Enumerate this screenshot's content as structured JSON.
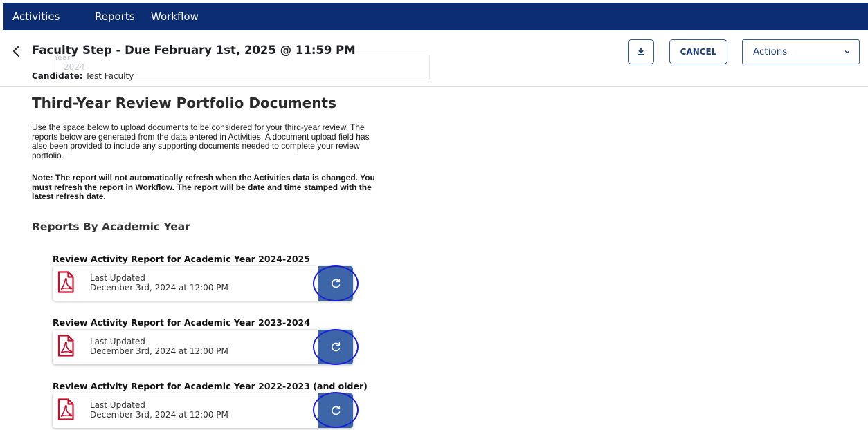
{
  "nav": {
    "items": [
      {
        "label": "Activities"
      },
      {
        "label": "Reports"
      },
      {
        "label": "Workflow"
      }
    ]
  },
  "header": {
    "title": "Faculty Step - Due February 1st, 2025 @ 11:59 PM",
    "ghost_label": "Year*",
    "ghost_value": "2024",
    "candidate_label": "Candidate:",
    "candidate_name": "Test Faculty",
    "cancel_label": "CANCEL",
    "actions_label": "Actions"
  },
  "content": {
    "section_title": "Third-Year Review Portfolio Documents",
    "description": "Use the space below to upload documents to be considered for your third-year review. The reports below are generated from the data entered in Activities. A document upload field has also been provided to include any supporting documents needed to complete your review portfolio.",
    "note_part1": "Note: The report will not automatically refresh when the Activities data is changed. You ",
    "note_emph": "must",
    "note_part2": " refresh the report in Workflow. The report will be date and time stamped with the latest refresh date.",
    "reports_heading": "Reports By Academic Year",
    "reports": [
      {
        "title": "Review Activity Report for Academic Year 2024-2025",
        "status_label": "Last Updated",
        "updated": "December 3rd, 2024 at 12:00 PM"
      },
      {
        "title": "Review Activity Report for Academic Year 2023-2024",
        "status_label": "Last Updated",
        "updated": "December 3rd, 2024 at 12:00 PM"
      },
      {
        "title": "Review Activity Report for Academic Year 2022-2023 (and older)",
        "status_label": "Last Updated",
        "updated": "December 3rd, 2024 at 12:00 PM"
      }
    ]
  },
  "colors": {
    "nav_bg": "#0d2d73",
    "accent": "#2d5aa0",
    "refresh_bg": "#3d66a8",
    "pdf_red": "#c8102e",
    "highlight": "#1a1fd6"
  },
  "icons": [
    "chevron-left-icon",
    "download-icon",
    "chevron-down-icon",
    "pdf-file-icon",
    "refresh-icon"
  ]
}
